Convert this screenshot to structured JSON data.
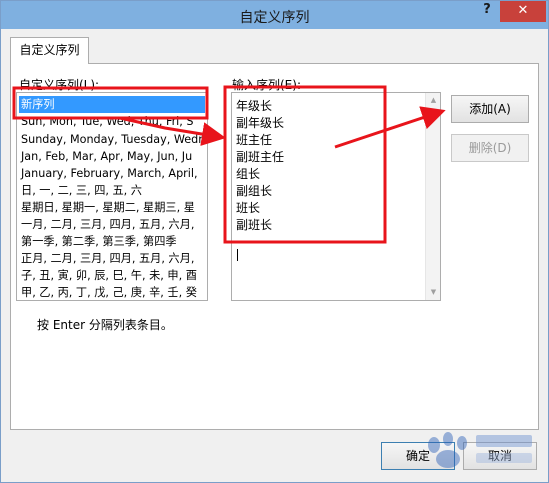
{
  "window": {
    "title": "自定义序列",
    "help_glyph": "?",
    "close_glyph": "✕"
  },
  "tab": {
    "label": "自定义序列"
  },
  "custom_lists": {
    "label": "自定义序列(L):",
    "items": [
      "新序列",
      "Sun, Mon, Tue, Wed, Thu, Fri, S",
      "Sunday, Monday, Tuesday, Wedn",
      "Jan, Feb, Mar, Apr, May, Jun, Ju",
      "January, February, March, April,",
      "日, 一, 二, 三, 四, 五, 六",
      "星期日, 星期一, 星期二, 星期三, 星",
      "一月, 二月, 三月, 四月, 五月, 六月,",
      "第一季, 第二季, 第三季, 第四季",
      "正月, 二月, 三月, 四月, 五月, 六月,",
      "子, 丑, 寅, 卯, 辰, 巳, 午, 未, 申, 酉",
      "甲, 乙, 丙, 丁, 戊, 己, 庚, 辛, 壬, 癸"
    ]
  },
  "entries": {
    "label": "输入序列(E):",
    "lines": [
      "年级长",
      "副年级长",
      "班主任",
      "副班主任",
      "组长",
      "副组长",
      "班长",
      "副班长"
    ]
  },
  "buttons": {
    "add": "添加(A)",
    "delete": "删除(D)",
    "ok": "确定",
    "cancel": "取消"
  },
  "hint": "按 Enter 分隔列表条目。",
  "colors": {
    "annotation_red": "#e8141b",
    "selection_blue": "#3399ff",
    "titlebar": "#7fb0e0",
    "close_red": "#c8413b"
  }
}
